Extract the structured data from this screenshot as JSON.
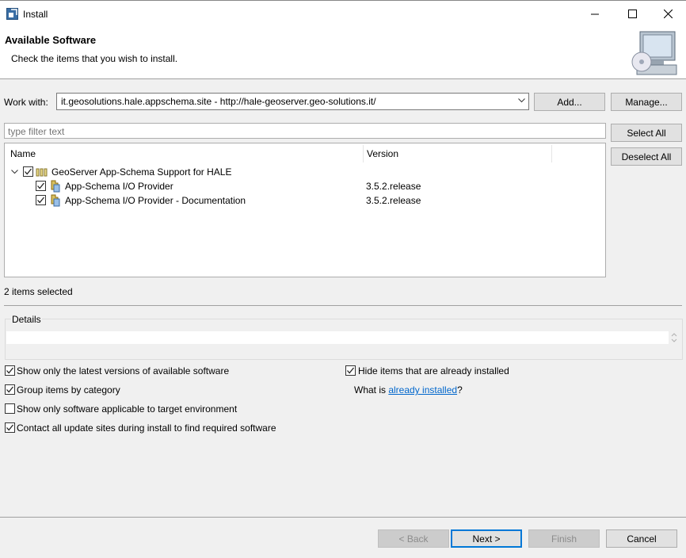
{
  "window": {
    "title": "Install"
  },
  "banner": {
    "title": "Available Software",
    "message": "Check the items that you wish to install."
  },
  "work_with": {
    "label": "Work with:",
    "value": "it.geosolutions.hale.appschema.site - http://hale-geoserver.geo-solutions.it/",
    "add_label": "Add...",
    "manage_label": "Manage..."
  },
  "filter": {
    "placeholder": "type filter text"
  },
  "buttons": {
    "select_all": "Select All",
    "deselect_all": "Deselect All"
  },
  "tree": {
    "columns": [
      "Name",
      "Version"
    ],
    "category": {
      "name": "GeoServer App-Schema Support for HALE",
      "checked": true,
      "expanded": true
    },
    "items": [
      {
        "name": "App-Schema I/O Provider",
        "version": "3.5.2.release",
        "checked": true
      },
      {
        "name": "App-Schema I/O Provider - Documentation",
        "version": "3.5.2.release",
        "checked": true
      }
    ]
  },
  "selection_status": "2 items selected",
  "details": {
    "label": "Details"
  },
  "options": {
    "latest_versions": {
      "label": "Show only the latest versions of available software",
      "checked": true
    },
    "group_by_category": {
      "label": "Group items by category",
      "checked": true
    },
    "applicable_only": {
      "label": "Show only software applicable to target environment",
      "checked": false
    },
    "contact_sites": {
      "label": "Contact all update sites during install to find required software",
      "checked": true
    },
    "hide_installed": {
      "label": "Hide items that are already installed",
      "checked": true
    },
    "what_is_prefix": "What is ",
    "what_is_link": "already installed",
    "what_is_suffix": "?"
  },
  "footer": {
    "back": "< Back",
    "next": "Next >",
    "finish": "Finish",
    "cancel": "Cancel"
  }
}
